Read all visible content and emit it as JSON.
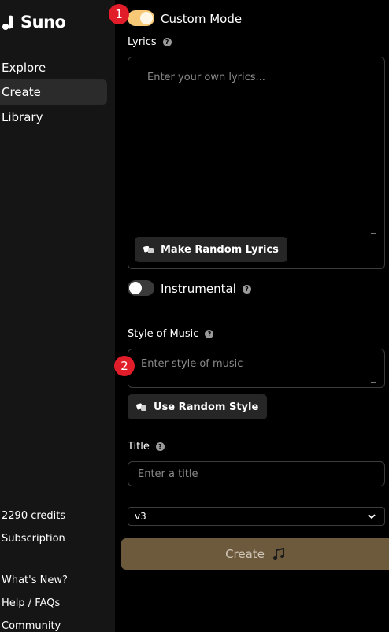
{
  "brand": {
    "name": "Suno"
  },
  "sidebar": {
    "nav": [
      {
        "label": "Explore"
      },
      {
        "label": "Create"
      },
      {
        "label": "Library"
      }
    ],
    "credits": "2290 credits",
    "links": [
      "Subscription",
      "What's New?",
      "Help / FAQs",
      "Community"
    ]
  },
  "form": {
    "custom_mode": {
      "label": "Custom Mode",
      "on": true
    },
    "lyrics": {
      "label": "Lyrics",
      "placeholder": "Enter your own lyrics..."
    },
    "random_lyrics_button": "Make Random Lyrics",
    "instrumental": {
      "label": "Instrumental",
      "on": false
    },
    "style": {
      "label": "Style of Music",
      "placeholder": "Enter style of music"
    },
    "random_style_button": "Use Random Style",
    "title": {
      "label": "Title",
      "placeholder": "Enter a title"
    },
    "version": {
      "selected": "v3"
    },
    "create_button": "Create"
  },
  "annotations": {
    "badge_1": "1",
    "badge_2": "2"
  },
  "colors": {
    "toggle_on": "#f7c876",
    "create_button": "#6d5a3d",
    "badge": "#e11d2a",
    "sidebar_bg": "#151515"
  },
  "icons": [
    "suno-logo-icon",
    "help-icon",
    "dice-icon",
    "chevron-down-icon",
    "music-note-icon"
  ]
}
